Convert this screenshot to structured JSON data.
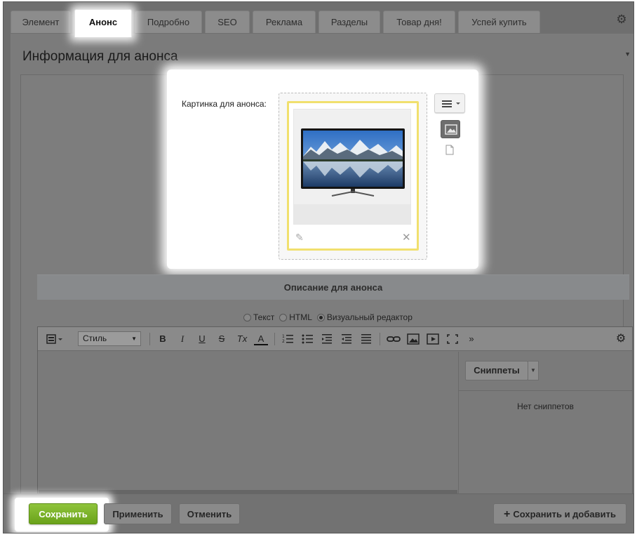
{
  "tabs": [
    {
      "label": "Элемент",
      "active": false
    },
    {
      "label": "Анонс",
      "active": true
    },
    {
      "label": "Подробно",
      "active": false
    },
    {
      "label": "SEO",
      "active": false
    },
    {
      "label": "Реклама",
      "active": false
    },
    {
      "label": "Разделы",
      "active": false
    },
    {
      "label": "Товар дня!",
      "active": false
    },
    {
      "label": "Успей купить",
      "active": false
    }
  ],
  "section": {
    "title": "Информация для анонса"
  },
  "preview_image": {
    "label": "Картинка для анонса:"
  },
  "description": {
    "title": "Описание для анонса",
    "modes": [
      {
        "label": "Текст",
        "selected": false
      },
      {
        "label": "HTML",
        "selected": false
      },
      {
        "label": "Визуальный редактор",
        "selected": true
      }
    ]
  },
  "editor": {
    "style_select": "Стиль",
    "toolbar_icons": [
      "template-icon",
      "bold-icon",
      "italic-icon",
      "underline-icon",
      "strikethrough-icon",
      "clear-format-icon",
      "font-color-icon",
      "ordered-list-icon",
      "unordered-list-icon",
      "outdent-icon",
      "indent-icon",
      "justify-icon",
      "link-icon",
      "image-icon",
      "video-icon",
      "fullscreen-icon",
      "more-icon",
      "settings-icon"
    ],
    "tb": {
      "bold": "B",
      "italic": "I",
      "underline": "U",
      "strike": "S",
      "clear": "Tx",
      "color": "A",
      "more": "»"
    }
  },
  "snippets": {
    "button_label": "Сниппеты",
    "empty_text": "Нет сниппетов"
  },
  "footer": {
    "save": "Сохранить",
    "apply": "Применить",
    "cancel": "Отменить",
    "save_add": "Сохранить и добавить"
  },
  "colors": {
    "save_button": "#7ab12a",
    "highlight_frame": "#f1e06e"
  }
}
